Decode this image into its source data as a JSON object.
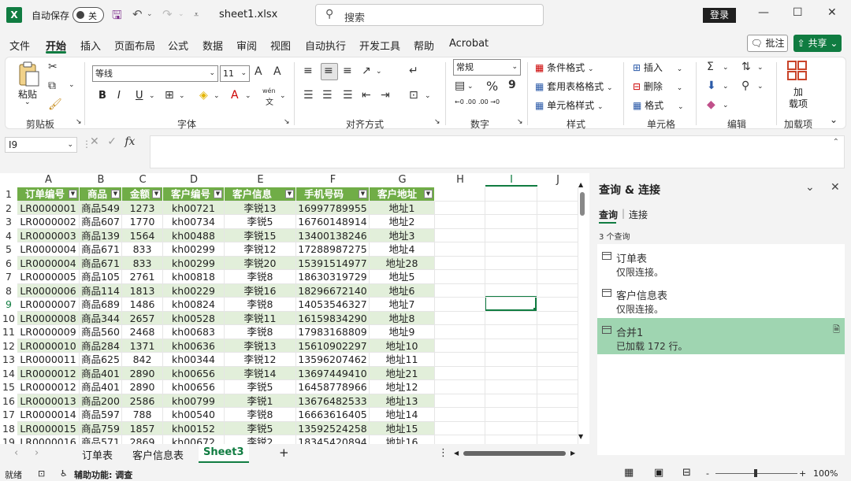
{
  "titlebar": {
    "app_logo": "X",
    "autosave_label": "自动保存",
    "autosave_state": "关",
    "filename": "sheet1.xlsx",
    "search_placeholder": "搜索",
    "login": "登录",
    "icons": [
      "save-icon",
      "undo-icon",
      "redo-icon",
      "customize-icon",
      "minimize-icon",
      "maximize-icon",
      "close-icon"
    ]
  },
  "menu": {
    "items": [
      "文件",
      "开始",
      "插入",
      "页面布局",
      "公式",
      "数据",
      "审阅",
      "视图",
      "自动执行",
      "开发工具",
      "帮助",
      "Acrobat"
    ],
    "active": "开始",
    "comment": "批注",
    "share": "共享"
  },
  "ribbon": {
    "groups": [
      "剪贴板",
      "字体",
      "对齐方式",
      "数字",
      "样式",
      "单元格",
      "编辑",
      "加载项"
    ],
    "paste": "粘贴",
    "font_name": "等线",
    "font_size": "11",
    "bold": "B",
    "italic": "I",
    "underline": "U",
    "number_format": "常规",
    "percent": "%",
    "comma": "9",
    "conditional_format": "条件格式",
    "table_format": "套用表格格式",
    "cell_style": "单元格样式",
    "insert": "插入",
    "delete": "删除",
    "format": "格式",
    "addin_line1": "加",
    "addin_line2": "载项",
    "wen": "wén",
    "wen_char": "文",
    "font_grow": "A",
    "font_shrink": "A",
    "font_color": "A",
    "decimals_up": "←0 .00",
    "decimals_down": ".00 →0"
  },
  "formula_bar": {
    "name_box": "I9",
    "fx": "fx",
    "content": ""
  },
  "grid": {
    "columns": [
      "A",
      "B",
      "C",
      "D",
      "E",
      "F",
      "G",
      "H",
      "I",
      "J"
    ],
    "selected_column": "I",
    "selected_row": "9",
    "headers": [
      "订单编号",
      "商品",
      "金额",
      "客户编号",
      "客户信息",
      "手机号码",
      "客户地址"
    ],
    "rows": [
      {
        "n": "2",
        "v": [
          "LR0000001",
          "商品549",
          "1273",
          "kh00721",
          "李锐13",
          "16997789955",
          "地址1"
        ]
      },
      {
        "n": "3",
        "v": [
          "LR0000002",
          "商品607",
          "1770",
          "kh00734",
          "李锐5",
          "16760148914",
          "地址2"
        ]
      },
      {
        "n": "4",
        "v": [
          "LR0000003",
          "商品139",
          "1564",
          "kh00488",
          "李锐15",
          "13400138246",
          "地址3"
        ]
      },
      {
        "n": "5",
        "v": [
          "LR0000004",
          "商品671",
          "833",
          "kh00299",
          "李锐12",
          "17288987275",
          "地址4"
        ]
      },
      {
        "n": "6",
        "v": [
          "LR0000004",
          "商品671",
          "833",
          "kh00299",
          "李锐20",
          "15391514977",
          "地址28"
        ]
      },
      {
        "n": "7",
        "v": [
          "LR0000005",
          "商品105",
          "2761",
          "kh00818",
          "李锐8",
          "18630319729",
          "地址5"
        ]
      },
      {
        "n": "8",
        "v": [
          "LR0000006",
          "商品114",
          "1813",
          "kh00229",
          "李锐16",
          "18296672140",
          "地址6"
        ]
      },
      {
        "n": "9",
        "v": [
          "LR0000007",
          "商品689",
          "1486",
          "kh00824",
          "李锐8",
          "14053546327",
          "地址7"
        ]
      },
      {
        "n": "10",
        "v": [
          "LR0000008",
          "商品344",
          "2657",
          "kh00528",
          "李锐11",
          "16159834290",
          "地址8"
        ]
      },
      {
        "n": "11",
        "v": [
          "LR0000009",
          "商品560",
          "2468",
          "kh00683",
          "李锐8",
          "17983168809",
          "地址9"
        ]
      },
      {
        "n": "12",
        "v": [
          "LR0000010",
          "商品284",
          "1371",
          "kh00636",
          "李锐13",
          "15610902297",
          "地址10"
        ]
      },
      {
        "n": "13",
        "v": [
          "LR0000011",
          "商品625",
          "842",
          "kh00344",
          "李锐12",
          "13596207462",
          "地址11"
        ]
      },
      {
        "n": "14",
        "v": [
          "LR0000012",
          "商品401",
          "2890",
          "kh00656",
          "李锐14",
          "13697449410",
          "地址21"
        ]
      },
      {
        "n": "15",
        "v": [
          "LR0000012",
          "商品401",
          "2890",
          "kh00656",
          "李锐5",
          "16458778966",
          "地址12"
        ]
      },
      {
        "n": "16",
        "v": [
          "LR0000013",
          "商品200",
          "2586",
          "kh00799",
          "李锐1",
          "13676482533",
          "地址13"
        ]
      },
      {
        "n": "17",
        "v": [
          "LR0000014",
          "商品597",
          "788",
          "kh00540",
          "李锐8",
          "16663616405",
          "地址14"
        ]
      },
      {
        "n": "18",
        "v": [
          "LR0000015",
          "商品759",
          "1857",
          "kh00152",
          "李锐5",
          "13592524258",
          "地址15"
        ]
      },
      {
        "n": "19",
        "v": [
          "LR0000016",
          "商品571",
          "2869",
          "kh00672",
          "李锐2",
          "18345420894",
          "地址16"
        ]
      }
    ]
  },
  "panel": {
    "title": "查询 & 连接",
    "tabs": [
      "查询",
      "连接"
    ],
    "count": "3 个查询",
    "queries": [
      {
        "name": "订单表",
        "desc": "仅限连接。"
      },
      {
        "name": "客户信息表",
        "desc": "仅限连接。"
      },
      {
        "name": "合并1",
        "desc": "已加载 172 行。"
      }
    ]
  },
  "sheets": {
    "tabs": [
      "订单表",
      "客户信息表",
      "Sheet3"
    ],
    "active": "Sheet3",
    "add": "+"
  },
  "status": {
    "ready": "就绪",
    "accessibility": "辅助功能: 调查",
    "zoom": "100%",
    "zoom_out": "-",
    "zoom_in": "+"
  }
}
